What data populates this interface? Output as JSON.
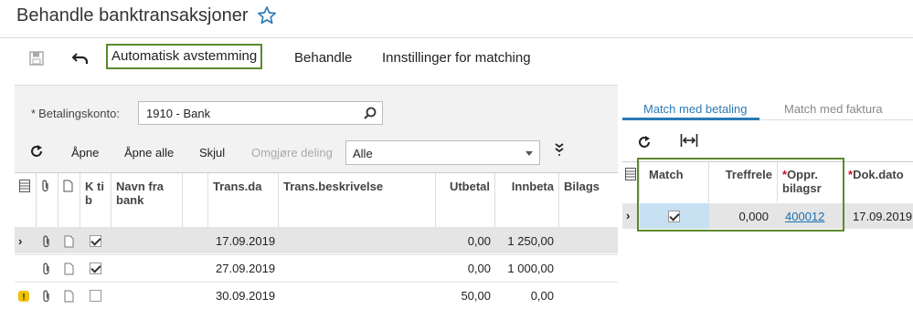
{
  "page": {
    "title": "Behandle banktransaksjoner"
  },
  "toolbar": {
    "save_icon": "save-icon",
    "undo_icon": "undo-icon",
    "auto_match": "Automatisk avstemming",
    "process": "Behandle",
    "match_settings": "Innstillinger for matching"
  },
  "filter": {
    "account_label": "Betalingskonto:",
    "account_value": "1910 - Bank",
    "open": "Åpne",
    "open_all": "Åpne alle",
    "hide": "Skjul",
    "undo_split": "Omgjøre deling",
    "status_select": "Alle"
  },
  "grid": {
    "headers": {
      "ktib": "K ti b",
      "bank_name": "Navn fra bank",
      "trans_date": "Trans.da",
      "trans_desc": "Trans.beskrivelse",
      "disbursement": "Utbetal",
      "receipt": "Innbeta",
      "bilag": "Bilags"
    },
    "rows": [
      {
        "date": "17.09.2019",
        "out": "0,00",
        "in": "1 250,00",
        "checked": true,
        "selected": true,
        "warning": false
      },
      {
        "date": "27.09.2019",
        "out": "0,00",
        "in": "1 000,00",
        "checked": true,
        "selected": false,
        "warning": false
      },
      {
        "date": "30.09.2019",
        "out": "50,00",
        "in": "0,00",
        "checked": false,
        "selected": false,
        "warning": true
      }
    ]
  },
  "right": {
    "tab_payment": "Match med betaling",
    "tab_invoice": "Match med faktura",
    "headers": {
      "match": "Match",
      "relevance": "Treffrele",
      "orig_doc": "Oppr. bilagsr",
      "doc_date": "Dok.dato"
    },
    "row": {
      "relevance": "0,000",
      "doc_nbr": "400012",
      "doc_date": "17.09.2019",
      "match_checked": true
    }
  },
  "colors": {
    "accent": "#2a7ab5",
    "highlight_border": "#5a8a2d",
    "selected_row": "#e5e5e5",
    "required_star": "#c8102e"
  }
}
